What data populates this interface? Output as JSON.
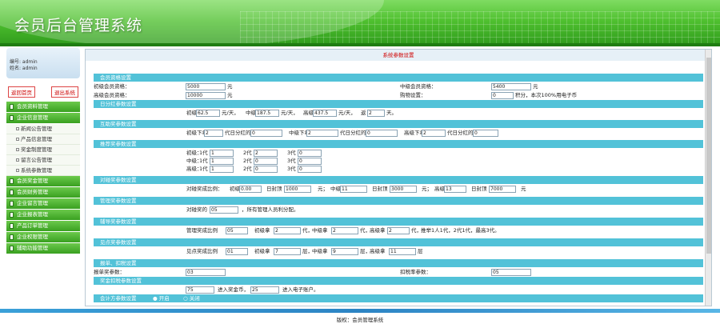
{
  "header": {
    "title": "会员后台管理系统"
  },
  "sidebar": {
    "user_id": "编号: admin",
    "user_name": "姓名: admin",
    "home_btn": "返回首页",
    "exit_btn": "退出系统",
    "menu": [
      {
        "label": "会员资料管理",
        "type": "head"
      },
      {
        "label": "企业信息管理",
        "type": "head"
      },
      {
        "label": "新闻公告管理",
        "type": "sub"
      },
      {
        "label": "产品信息管理",
        "type": "sub"
      },
      {
        "label": "奖金制度管理",
        "type": "sub"
      },
      {
        "label": "留言公告管理",
        "type": "sub"
      },
      {
        "label": "系统参数管理",
        "type": "sub"
      },
      {
        "label": "会员奖金管理",
        "type": "head"
      },
      {
        "label": "会员财务管理",
        "type": "head"
      },
      {
        "label": "企业留言管理",
        "type": "head"
      },
      {
        "label": "企业报表管理",
        "type": "head"
      },
      {
        "label": "产品订单管理",
        "type": "head"
      },
      {
        "label": "企业权限管理",
        "type": "head"
      },
      {
        "label": "辅助功能管理",
        "type": "head"
      }
    ]
  },
  "main": {
    "title": "系统参数设置",
    "sections": {
      "s1": "会员资格设置",
      "s2": "日分红参数设置",
      "s3": "互助奖参数设置",
      "s4": "推荐奖参数设置",
      "s5": "对碰奖参数设置",
      "s6": "管理奖参数设置",
      "s7": "辅导奖参数设置",
      "s8": "见点奖参数设置",
      "s9": "报单、扣税设置",
      "s10": "奖金扣税参数设置",
      "s11": "会计方参数设置"
    },
    "membership": {
      "junior_label": "初级会员资格：",
      "junior_value": "5000",
      "junior_unit": "元",
      "mid_label": "中级会员资格：",
      "mid_value": "5400",
      "mid_unit": "元",
      "senior_label": "高级会员资格：",
      "senior_value": "10000",
      "senior_unit": "元",
      "shop_label": "购物设置：",
      "shop_value": "0",
      "shop_note": "积分，本次100%用电子币"
    },
    "daily": {
      "p1": "初级",
      "v1": "62.5",
      "u1": "元/天，",
      "p2": "中级",
      "v2": "187.5",
      "u2": "元/天，",
      "p3": "高级",
      "v3": "437.5",
      "u3": "元/天，",
      "p4": "返",
      "v4": "2",
      "u4": "天。"
    },
    "mutual": {
      "p1": "初级下拿",
      "v1": "2",
      "u1": "代日分红的",
      "v1b": "0",
      "p2": "中级下拿",
      "v2": "2",
      "u2": "代日分红的",
      "v2b": "0",
      "p3": "高级下拿",
      "v3": "2",
      "u3": "代日分红的",
      "v3b": "0"
    },
    "recommend": {
      "rows": [
        {
          "label": "初级：",
          "a_lab": "1代",
          "a": "1",
          "b_lab": "2代",
          "b": "2",
          "c_lab": "3代",
          "c": "0"
        },
        {
          "label": "中级：",
          "a_lab": "1代",
          "a": "1",
          "b_lab": "2代",
          "b": "0",
          "c_lab": "3代",
          "c": "0"
        },
        {
          "label": "高级：",
          "a_lab": "1代",
          "a": "1",
          "b_lab": "2代",
          "b": "0",
          "c_lab": "3代",
          "c": "0"
        }
      ]
    },
    "collision": {
      "label": "对碰奖成比例：",
      "p1": "初级",
      "v1": "0.00",
      "p1b": "日封顶",
      "v1b": "1000",
      "u1": "元；",
      "p2": "中级",
      "v2": "11",
      "p2b": "日封顶",
      "v2b": "3000",
      "u2": "元；",
      "p3": "高级",
      "v3": "13",
      "p3b": "日封顶",
      "v3b": "7000",
      "u3": "元"
    },
    "manage": {
      "label": "对碰奖的",
      "value": "05",
      "note": "，所有管理人员利分配。"
    },
    "tutor": {
      "label": "管理奖成比例",
      "v0": "05",
      "p1": "初级拿",
      "v1": "2",
      "u1": "代，",
      "p2": "中级拿",
      "v2": "2",
      "u2": "代，",
      "p3": "高级拿",
      "v3": "2",
      "u3": "代，",
      "note": "推举1人1代，2代1代，最高3代。"
    },
    "point": {
      "label": "见点奖成比例",
      "v0": "01",
      "p1": "初级拿",
      "v1": "7",
      "u1": "层，",
      "p2": "中级拿",
      "v2": "9",
      "u2": "层，",
      "p3": "高级拿",
      "v3": "11",
      "u3": "层"
    },
    "report": {
      "label": "报单奖参数：",
      "value": "03",
      "tax_label": "扣税率参数：",
      "tax_value": "05"
    },
    "bonus_tax": {
      "v1": "75",
      "t1": "进入奖金币，",
      "v2": "25",
      "t2": "进入电子账户。"
    },
    "account": {
      "on": "开启",
      "off": "关闭"
    }
  },
  "footer": {
    "text": "版权：会员管理系统"
  }
}
